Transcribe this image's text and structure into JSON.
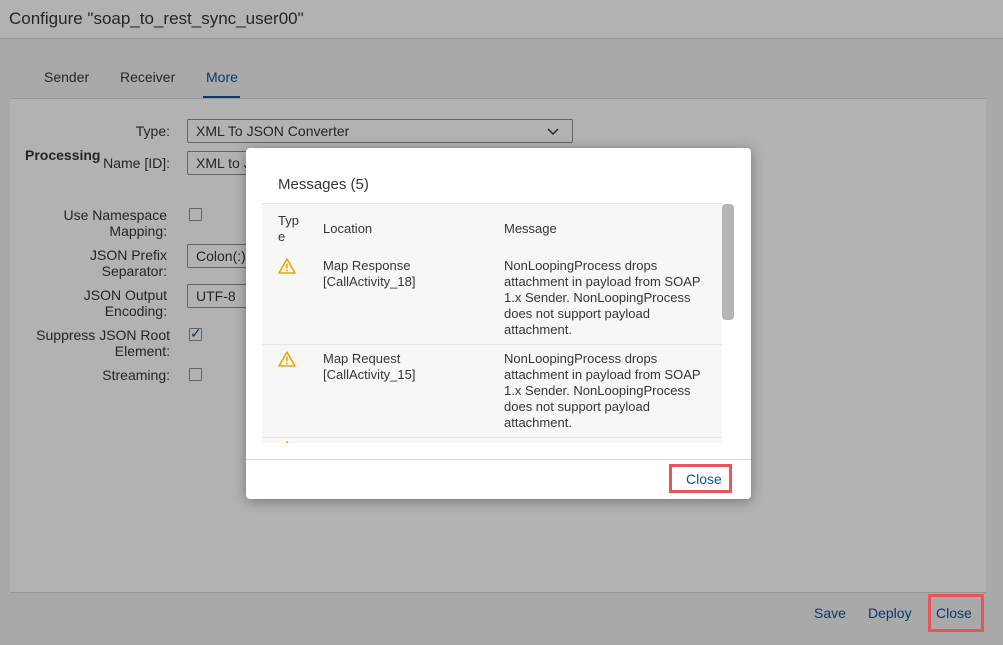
{
  "window": {
    "title": "Configure \"soap_to_rest_sync_user00\""
  },
  "tabs": [
    {
      "label": "Sender"
    },
    {
      "label": "Receiver"
    },
    {
      "label": "More"
    }
  ],
  "form": {
    "type_label": "Type:",
    "type_value": "XML To JSON Converter",
    "name_label": "Name [ID]:",
    "name_value": "XML to J",
    "section_processing": "Processing",
    "use_namespace_label_1": "Use Namespace",
    "use_namespace_label_2": "Mapping:",
    "json_prefix_label_1": "JSON Prefix",
    "json_prefix_label_2": "Separator:",
    "json_prefix_value": "Colon(:)",
    "json_output_label_1": "JSON Output",
    "json_output_label_2": "Encoding:",
    "json_output_value": "UTF-8",
    "suppress_root_label_1": "Suppress JSON Root",
    "suppress_root_label_2": "Element:",
    "streaming_label": "Streaming:"
  },
  "footer": {
    "save": "Save",
    "deploy": "Deploy",
    "close": "Close"
  },
  "dialog": {
    "title": "Messages (5)",
    "columns": {
      "type_1": "Typ",
      "type_2": "e",
      "location": "Location",
      "message": "Message"
    },
    "rows": [
      {
        "location_1": "Map Response",
        "location_2": "[CallActivity_18]",
        "message_1": "NonLoopingProcess drops",
        "message_2": "attachment in payload from SOAP",
        "message_3": "1.x Sender. NonLoopingProcess",
        "message_4": "does not support payload",
        "message_5": "attachment."
      },
      {
        "location_1": "Map Request",
        "location_2": "[CallActivity_15]",
        "message_1": "NonLoopingProcess drops",
        "message_2": "attachment in payload from SOAP",
        "message_3": "1.x Sender. NonLoopingProcess",
        "message_4": "does not support payload",
        "message_5": "attachment."
      }
    ],
    "close": "Close"
  },
  "colors": {
    "accent": "#0854a0",
    "warning": "#e9a800",
    "highlight": "#e8555a"
  }
}
